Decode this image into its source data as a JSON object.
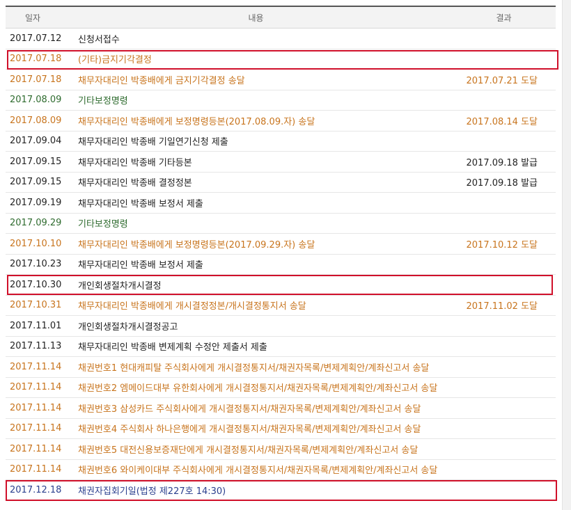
{
  "headers": {
    "date": "일자",
    "content": "내용",
    "result": "결과"
  },
  "rows": [
    {
      "date": "2017.07.12",
      "content": "신청서접수",
      "result": "",
      "color": "black"
    },
    {
      "date": "2017.07.18",
      "content": "(기타)금지기각결정",
      "result": "",
      "color": "orange",
      "highlight": true
    },
    {
      "date": "2017.07.18",
      "content": "채무자대리인 박종배에게 금지기각결정 송달",
      "result": "2017.07.21 도달",
      "color": "orange"
    },
    {
      "date": "2017.08.09",
      "content": "기타보정명령",
      "result": "",
      "color": "green"
    },
    {
      "date": "2017.08.09",
      "content": "채무자대리인 박종배에게 보정명령등본(2017.08.09.자) 송달",
      "result": "2017.08.14 도달",
      "color": "orange"
    },
    {
      "date": "2017.09.04",
      "content": "채무자대리인 박종배 기일연기신청 제출",
      "result": "",
      "color": "black"
    },
    {
      "date": "2017.09.15",
      "content": "채무자대리인 박종배 기타등본",
      "result": "2017.09.18 발급",
      "color": "black"
    },
    {
      "date": "2017.09.15",
      "content": "채무자대리인 박종배 결정정본",
      "result": "2017.09.18 발급",
      "color": "black"
    },
    {
      "date": "2017.09.19",
      "content": "채무자대리인 박종배 보정서 제출",
      "result": "",
      "color": "black"
    },
    {
      "date": "2017.09.29",
      "content": "기타보정명령",
      "result": "",
      "color": "green"
    },
    {
      "date": "2017.10.10",
      "content": "채무자대리인 박종배에게 보정명령등본(2017.09.29.자) 송달",
      "result": "2017.10.12 도달",
      "color": "orange"
    },
    {
      "date": "2017.10.23",
      "content": "채무자대리인 박종배 보정서 제출",
      "result": "",
      "color": "black"
    },
    {
      "date": "2017.10.30",
      "content": "개인회생절차개시결정",
      "result": "",
      "color": "black",
      "highlight": true
    },
    {
      "date": "2017.10.31",
      "content": "채무자대리인 박종배에게 개시결정정본/개시결정통지서 송달",
      "result": "2017.11.02 도달",
      "color": "orange"
    },
    {
      "date": "2017.11.01",
      "content": "개인회생절차개시결정공고",
      "result": "",
      "color": "black"
    },
    {
      "date": "2017.11.13",
      "content": "채무자대리인 박종배 변제계획 수정안 제출서 제출",
      "result": "",
      "color": "black"
    },
    {
      "date": "2017.11.14",
      "content": "채권번호1 현대캐피탈 주식회사에게 개시결정통지서/채권자목록/변제계획안/계좌신고서 송달",
      "result": "",
      "color": "orange"
    },
    {
      "date": "2017.11.14",
      "content": "채권번호2 엠메이드대부 유한회사에게 개시결정통지서/채권자목록/변제계획안/계좌신고서 송달",
      "result": "",
      "color": "orange"
    },
    {
      "date": "2017.11.14",
      "content": "채권번호3 삼성카드 주식회사에게 개시결정통지서/채권자목록/변제계획안/계좌신고서 송달",
      "result": "",
      "color": "orange"
    },
    {
      "date": "2017.11.14",
      "content": "채권번호4 주식회사 하나은행에게 개시결정통지서/채권자목록/변제계획안/계좌신고서 송달",
      "result": "",
      "color": "orange"
    },
    {
      "date": "2017.11.14",
      "content": "채권번호5 대전신용보증재단에게 개시결정통지서/채권자목록/변제계획안/계좌신고서 송달",
      "result": "",
      "color": "orange"
    },
    {
      "date": "2017.11.14",
      "content": "채권번호6 와이케이대부 주식회사에게 개시결정통지서/채권자목록/변제계획안/계좌신고서 송달",
      "result": "",
      "color": "orange"
    },
    {
      "date": "2017.12.18",
      "content": "채권자집회기일(법정 제227호 14:30)",
      "result": "",
      "color": "blue",
      "highlight": true
    }
  ],
  "colors": {
    "black": "#222222",
    "orange": "#c8741d",
    "green": "#2e6b2e",
    "blue": "#2a3f8e",
    "highlight": "#d0102a"
  }
}
